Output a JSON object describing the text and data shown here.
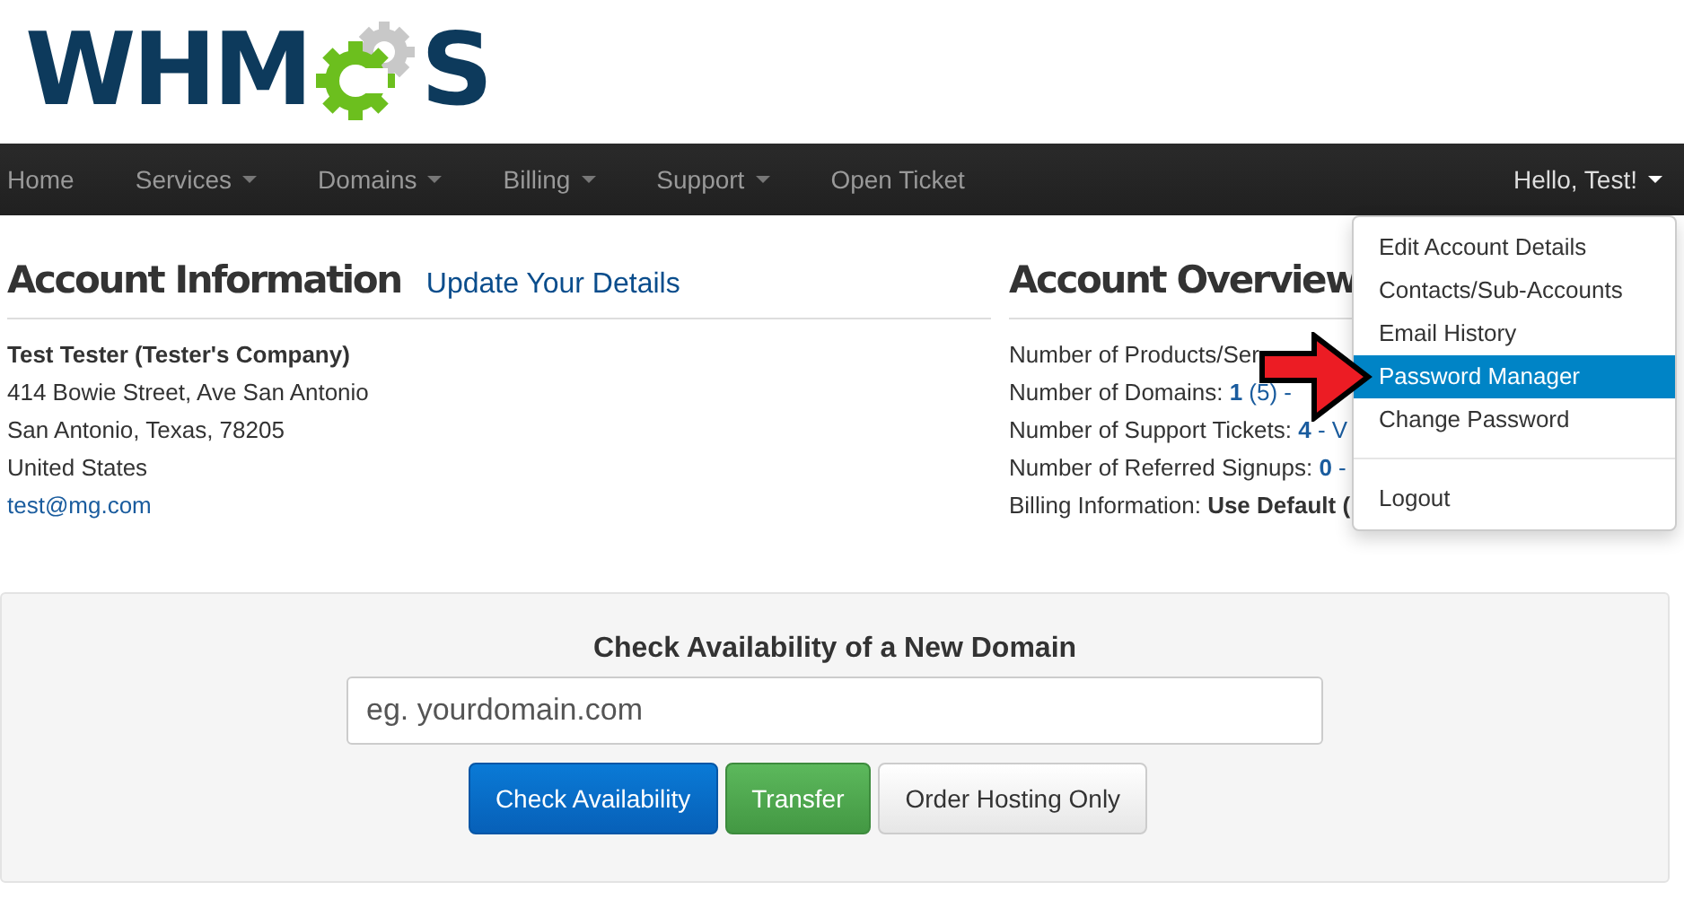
{
  "logo": {
    "before": "WHM",
    "after": "S"
  },
  "nav": {
    "items": [
      {
        "label": "Home",
        "dropdown": false
      },
      {
        "label": "Services",
        "dropdown": true
      },
      {
        "label": "Domains",
        "dropdown": true
      },
      {
        "label": "Billing",
        "dropdown": true
      },
      {
        "label": "Support",
        "dropdown": true
      },
      {
        "label": "Open Ticket",
        "dropdown": false
      }
    ],
    "user": {
      "label": "Hello, Test!"
    }
  },
  "user_menu": {
    "groups": [
      [
        {
          "label": "Edit Account Details",
          "selected": false
        },
        {
          "label": "Contacts/Sub-Accounts",
          "selected": false
        },
        {
          "label": "Email History",
          "selected": false
        },
        {
          "label": "Password Manager",
          "selected": true
        },
        {
          "label": "Change Password",
          "selected": false
        }
      ],
      [
        {
          "label": "Logout",
          "selected": false
        }
      ]
    ]
  },
  "account_information": {
    "title": "Account Information",
    "link": "Update Your Details",
    "name": "Test Tester (Tester's Company)",
    "lines": [
      "414 Bowie Street, Ave San Antonio",
      "San Antonio, Texas, 78205",
      "United States"
    ],
    "email": "test@mg.com"
  },
  "account_overview": {
    "title": "Account Overview",
    "lines": [
      {
        "label": "Number of Products/Ser"
      },
      {
        "label": "Number of Domains: ",
        "value": "**1** (5) -",
        "link": true
      },
      {
        "label": "Number of Support Tickets: ",
        "value": "**4** - V",
        "link": true
      },
      {
        "label": "Number of Referred Signups: ",
        "value": "**0** -",
        "link": true
      },
      {
        "label": "Billing Information: ",
        "value": "Use Default (",
        "link": false
      }
    ]
  },
  "domain_check": {
    "title": "Check Availability of a New Domain",
    "placeholder": "eg. yourdomain.com",
    "buttons": [
      {
        "label": "Check Availability",
        "kind": "primary"
      },
      {
        "label": "Transfer",
        "kind": "success"
      },
      {
        "label": "Order Hosting Only",
        "kind": "default"
      }
    ]
  }
}
